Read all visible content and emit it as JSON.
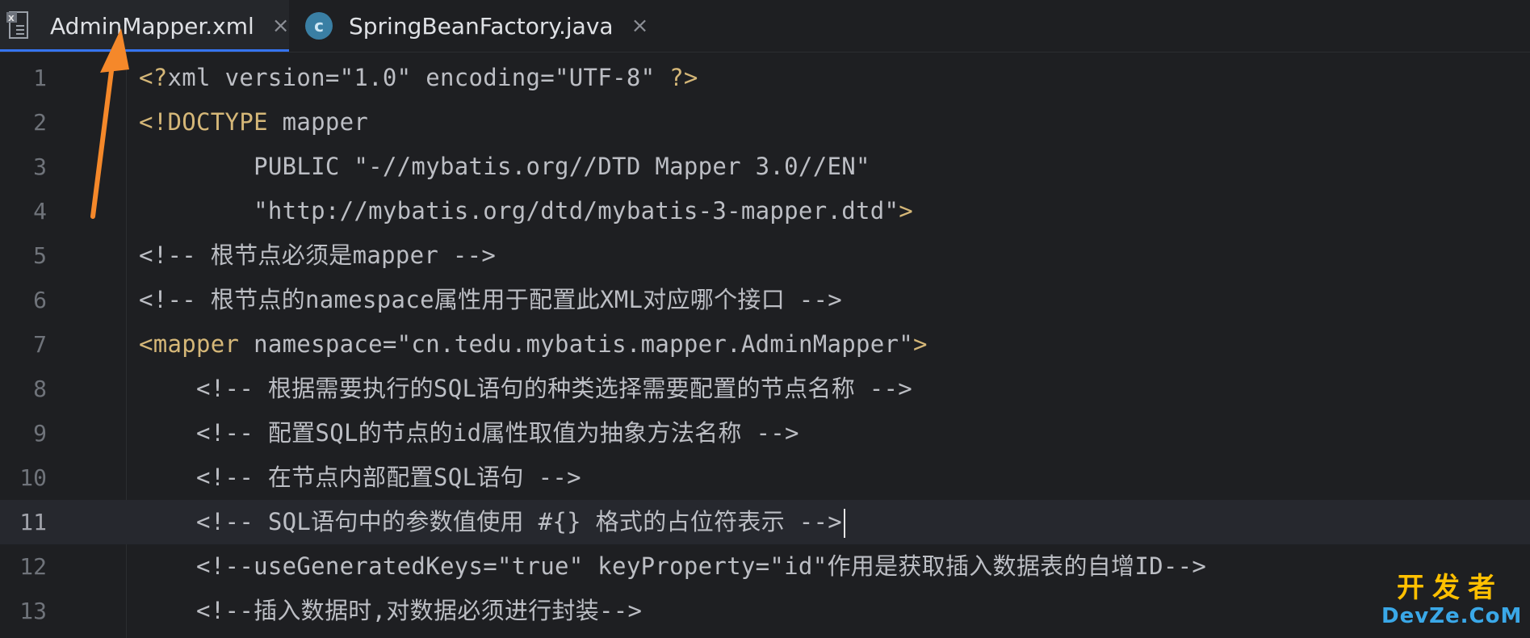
{
  "tabs": [
    {
      "label": "AdminMapper.xml",
      "icon": "xml-file-icon",
      "active": true,
      "close": "×"
    },
    {
      "label": "SpringBeanFactory.java",
      "icon": "java-class-icon",
      "active": false,
      "close": "×",
      "badge": "c"
    }
  ],
  "editor": {
    "current_line": 11,
    "lines": [
      {
        "number": "1",
        "segments": [
          {
            "t": "<?",
            "c": "tag"
          },
          {
            "t": "xml version=\"1.0\" encoding=\"UTF-8\" ",
            "c": "plain"
          },
          {
            "t": "?>",
            "c": "tag"
          }
        ]
      },
      {
        "number": "2",
        "segments": [
          {
            "t": "<!DOCTYPE ",
            "c": "tag"
          },
          {
            "t": "mapper",
            "c": "plain"
          }
        ]
      },
      {
        "number": "3",
        "segments": [
          {
            "t": "        PUBLIC \"-//mybatis.org//DTD Mapper 3.0//EN\"",
            "c": "plain"
          }
        ]
      },
      {
        "number": "4",
        "segments": [
          {
            "t": "        \"http://mybatis.org/dtd/mybatis-3-mapper.dtd\"",
            "c": "plain"
          },
          {
            "t": ">",
            "c": "tag"
          }
        ]
      },
      {
        "number": "5",
        "segments": [
          {
            "t": "<!-- 根节点必须是mapper -->",
            "c": "plain"
          }
        ]
      },
      {
        "number": "6",
        "segments": [
          {
            "t": "<!-- 根节点的namespace属性用于配置此XML对应哪个接口 -->",
            "c": "plain"
          }
        ]
      },
      {
        "number": "7",
        "segments": [
          {
            "t": "<mapper ",
            "c": "tag"
          },
          {
            "t": "namespace=\"cn.tedu.mybatis.mapper.AdminMapper\"",
            "c": "plain"
          },
          {
            "t": ">",
            "c": "tag"
          }
        ]
      },
      {
        "number": "8",
        "segments": [
          {
            "t": "    <!-- 根据需要执行的SQL语句的种类选择需要配置的节点名称 -->",
            "c": "plain"
          }
        ]
      },
      {
        "number": "9",
        "segments": [
          {
            "t": "    <!-- 配置SQL的节点的id属性取值为抽象方法名称 -->",
            "c": "plain"
          }
        ]
      },
      {
        "number": "10",
        "segments": [
          {
            "t": "    <!-- 在节点内部配置SQL语句 -->",
            "c": "plain"
          }
        ]
      },
      {
        "number": "11",
        "segments": [
          {
            "t": "    <!-- SQL语句中的参数值使用 #{} 格式的占位符表示 -->",
            "c": "plain"
          }
        ]
      },
      {
        "number": "12",
        "segments": [
          {
            "t": "    <!--useGeneratedKeys=\"true\" keyProperty=\"id\"作用是获取插入数据表的自增ID-->",
            "c": "plain"
          }
        ]
      },
      {
        "number": "13",
        "segments": [
          {
            "t": "    <!--插入数据时,对数据必须进行封装-->",
            "c": "plain"
          }
        ]
      }
    ]
  },
  "watermark": {
    "top": "开发者",
    "bottom": "DevZe.CoM"
  },
  "colors": {
    "background": "#1e1f22",
    "tag": "#d5b778",
    "text": "#bcbec4",
    "line_number": "#6f737a",
    "arrow": "#f5882a",
    "accent": "#3574f0"
  }
}
